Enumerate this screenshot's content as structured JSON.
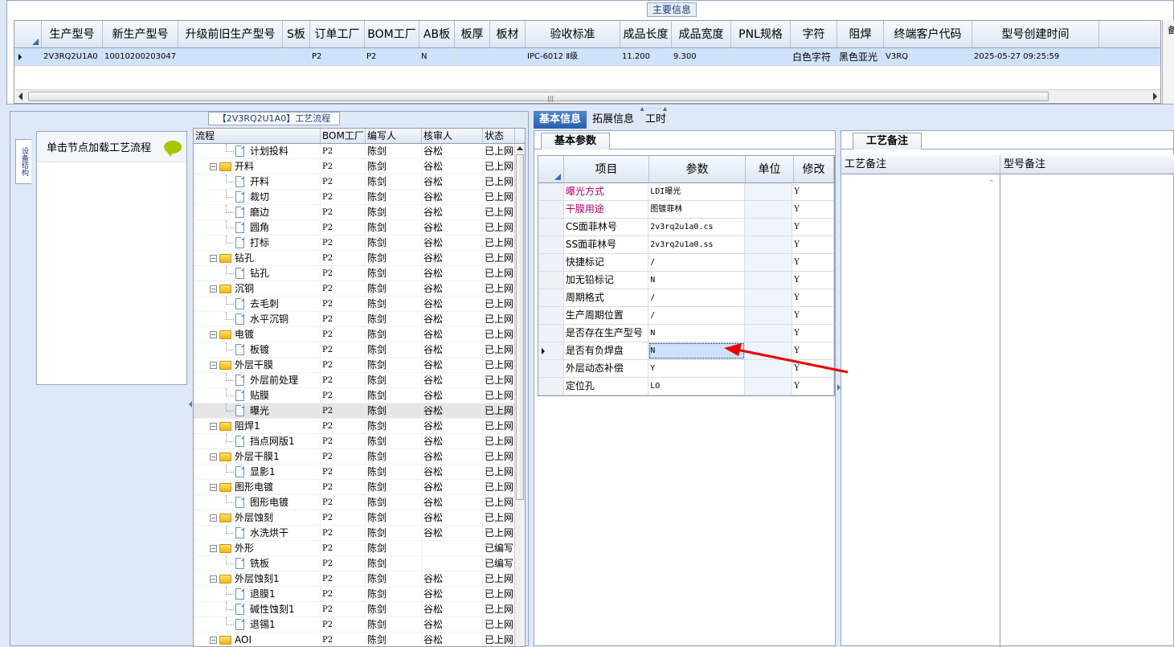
{
  "top": {
    "caption": "主要信息",
    "columns": [
      "生产型号",
      "新生产型号",
      "升级前旧生产型号",
      "S板",
      "订单工厂",
      "BOM工厂",
      "AB板",
      "板厚",
      "板材",
      "验收标准",
      "成品长度",
      "成品宽度",
      "PNL规格",
      "字符",
      "阻焊",
      "终端客户代码",
      "型号创建时间"
    ],
    "row": [
      "2V3RQ2U1A0",
      "10010200203047",
      "",
      "",
      "P2",
      "P2",
      "N",
      "",
      "",
      "IPC-6012 Ⅱ级",
      "11.200",
      "9.300",
      "",
      "白色字符",
      "黑色亚光",
      "V3RQ",
      "2025-05-27 09:25:59"
    ],
    "right_stub": "备"
  },
  "flow": {
    "caption": "【2V3RQ2U1A0】工艺流程",
    "side_tab": "设备结构",
    "hint": "单击节点加载工艺流程",
    "columns": [
      "流程",
      "BOM工厂",
      "编写人",
      "核审人",
      "状态"
    ],
    "rows": [
      {
        "type": "doc",
        "name": "计划投料",
        "bom": "P2",
        "writer": "陈剑",
        "reviewer": "谷松",
        "status": "已上网"
      },
      {
        "type": "folder",
        "name": "开料",
        "bom": "P2",
        "writer": "陈剑",
        "reviewer": "谷松",
        "status": "已上网"
      },
      {
        "type": "doc",
        "name": "开料",
        "bom": "P2",
        "writer": "陈剑",
        "reviewer": "谷松",
        "status": "已上网"
      },
      {
        "type": "doc",
        "name": "裁切",
        "bom": "P2",
        "writer": "陈剑",
        "reviewer": "谷松",
        "status": "已上网"
      },
      {
        "type": "doc",
        "name": "磨边",
        "bom": "P2",
        "writer": "陈剑",
        "reviewer": "谷松",
        "status": "已上网"
      },
      {
        "type": "doc",
        "name": "圆角",
        "bom": "P2",
        "writer": "陈剑",
        "reviewer": "谷松",
        "status": "已上网"
      },
      {
        "type": "doc",
        "name": "打标",
        "bom": "P2",
        "writer": "陈剑",
        "reviewer": "谷松",
        "status": "已上网"
      },
      {
        "type": "folder",
        "name": "钻孔",
        "bom": "P2",
        "writer": "陈剑",
        "reviewer": "谷松",
        "status": "已上网"
      },
      {
        "type": "doc",
        "name": "钻孔",
        "bom": "P2",
        "writer": "陈剑",
        "reviewer": "谷松",
        "status": "已上网"
      },
      {
        "type": "folder",
        "name": "沉铜",
        "bom": "P2",
        "writer": "陈剑",
        "reviewer": "谷松",
        "status": "已上网"
      },
      {
        "type": "doc",
        "name": "去毛刺",
        "bom": "P2",
        "writer": "陈剑",
        "reviewer": "谷松",
        "status": "已上网"
      },
      {
        "type": "doc",
        "name": "水平沉铜",
        "bom": "P2",
        "writer": "陈剑",
        "reviewer": "谷松",
        "status": "已上网"
      },
      {
        "type": "folder",
        "name": "电镀",
        "bom": "P2",
        "writer": "陈剑",
        "reviewer": "谷松",
        "status": "已上网"
      },
      {
        "type": "doc",
        "name": "板镀",
        "bom": "P2",
        "writer": "陈剑",
        "reviewer": "谷松",
        "status": "已上网"
      },
      {
        "type": "folder",
        "name": "外层干膜",
        "bom": "P2",
        "writer": "陈剑",
        "reviewer": "谷松",
        "status": "已上网"
      },
      {
        "type": "doc",
        "name": "外层前处理",
        "bom": "P2",
        "writer": "陈剑",
        "reviewer": "谷松",
        "status": "已上网"
      },
      {
        "type": "doc",
        "name": "贴膜",
        "bom": "P2",
        "writer": "陈剑",
        "reviewer": "谷松",
        "status": "已上网"
      },
      {
        "type": "doc",
        "name": "曝光",
        "bom": "P2",
        "writer": "陈剑",
        "reviewer": "谷松",
        "status": "已上网",
        "selected": true
      },
      {
        "type": "folder",
        "name": "阻焊1",
        "bom": "P2",
        "writer": "陈剑",
        "reviewer": "谷松",
        "status": "已上网"
      },
      {
        "type": "doc",
        "name": "挡点网版1",
        "bom": "P2",
        "writer": "陈剑",
        "reviewer": "谷松",
        "status": "已上网"
      },
      {
        "type": "folder",
        "name": "外层干膜1",
        "bom": "P2",
        "writer": "陈剑",
        "reviewer": "谷松",
        "status": "已上网"
      },
      {
        "type": "doc",
        "name": "显影1",
        "bom": "P2",
        "writer": "陈剑",
        "reviewer": "谷松",
        "status": "已上网"
      },
      {
        "type": "folder",
        "name": "图形电镀",
        "bom": "P2",
        "writer": "陈剑",
        "reviewer": "谷松",
        "status": "已上网"
      },
      {
        "type": "doc",
        "name": "图形电镀",
        "bom": "P2",
        "writer": "陈剑",
        "reviewer": "谷松",
        "status": "已上网"
      },
      {
        "type": "folder",
        "name": "外层蚀刻",
        "bom": "P2",
        "writer": "陈剑",
        "reviewer": "谷松",
        "status": "已上网"
      },
      {
        "type": "doc",
        "name": "水洗烘干",
        "bom": "P2",
        "writer": "陈剑",
        "reviewer": "谷松",
        "status": "已上网"
      },
      {
        "type": "folder",
        "name": "外形",
        "bom": "P2",
        "writer": "陈剑",
        "reviewer": "",
        "status": "已编写"
      },
      {
        "type": "doc",
        "name": "铣板",
        "bom": "P2",
        "writer": "陈剑",
        "reviewer": "",
        "status": "已编写"
      },
      {
        "type": "folder",
        "name": "外层蚀刻1",
        "bom": "P2",
        "writer": "陈剑",
        "reviewer": "谷松",
        "status": "已上网"
      },
      {
        "type": "doc",
        "name": "退膜1",
        "bom": "P2",
        "writer": "陈剑",
        "reviewer": "谷松",
        "status": "已上网"
      },
      {
        "type": "doc",
        "name": "碱性蚀刻1",
        "bom": "P2",
        "writer": "陈剑",
        "reviewer": "谷松",
        "status": "已上网"
      },
      {
        "type": "doc",
        "name": "退锡1",
        "bom": "P2",
        "writer": "陈剑",
        "reviewer": "谷松",
        "status": "已上网"
      },
      {
        "type": "folder",
        "name": "AOI",
        "bom": "P2",
        "writer": "陈剑",
        "reviewer": "谷松",
        "status": "已上网"
      }
    ]
  },
  "right": {
    "tabs": [
      "基本信息",
      "拓展信息",
      "工时"
    ],
    "subtab": "基本参数",
    "columns": [
      "项目",
      "参数",
      "单位",
      "修改"
    ],
    "rows": [
      {
        "key": "曝光方式",
        "value": "LDI曝光",
        "unit": "",
        "edit": "Y",
        "highlight": true
      },
      {
        "key": "干膜用途",
        "value": "图镀菲林",
        "unit": "",
        "edit": "Y",
        "highlight": true
      },
      {
        "key": "CS面菲林号",
        "value": "2v3rq2u1a0.cs",
        "unit": "",
        "edit": "Y"
      },
      {
        "key": "SS面菲林号",
        "value": "2v3rq2u1a0.ss",
        "unit": "",
        "edit": "Y"
      },
      {
        "key": "快捷标记",
        "value": "/",
        "unit": "",
        "edit": "Y"
      },
      {
        "key": "加无铅标记",
        "value": "N",
        "unit": "",
        "edit": "Y"
      },
      {
        "key": "周期格式",
        "value": "/",
        "unit": "",
        "edit": "Y"
      },
      {
        "key": "生产周期位置",
        "value": "/",
        "unit": "",
        "edit": "Y"
      },
      {
        "key": "是否存在生产型号",
        "value": "N",
        "unit": "",
        "edit": "Y"
      },
      {
        "key": "是否有负焊盘",
        "value": "N",
        "unit": "",
        "edit": "Y",
        "current": true
      },
      {
        "key": "外层动态补偿",
        "value": "Y",
        "unit": "",
        "edit": "Y"
      },
      {
        "key": "定位孔",
        "value": "LO",
        "unit": "",
        "edit": "Y"
      }
    ],
    "memo_subtab": "工艺备注",
    "memo_columns": [
      "工艺备注",
      "型号备注"
    ]
  },
  "colors": {
    "accent": "#2b5fae",
    "highlight_key": "#b0006e",
    "annotation_arrow": "#e60000"
  }
}
